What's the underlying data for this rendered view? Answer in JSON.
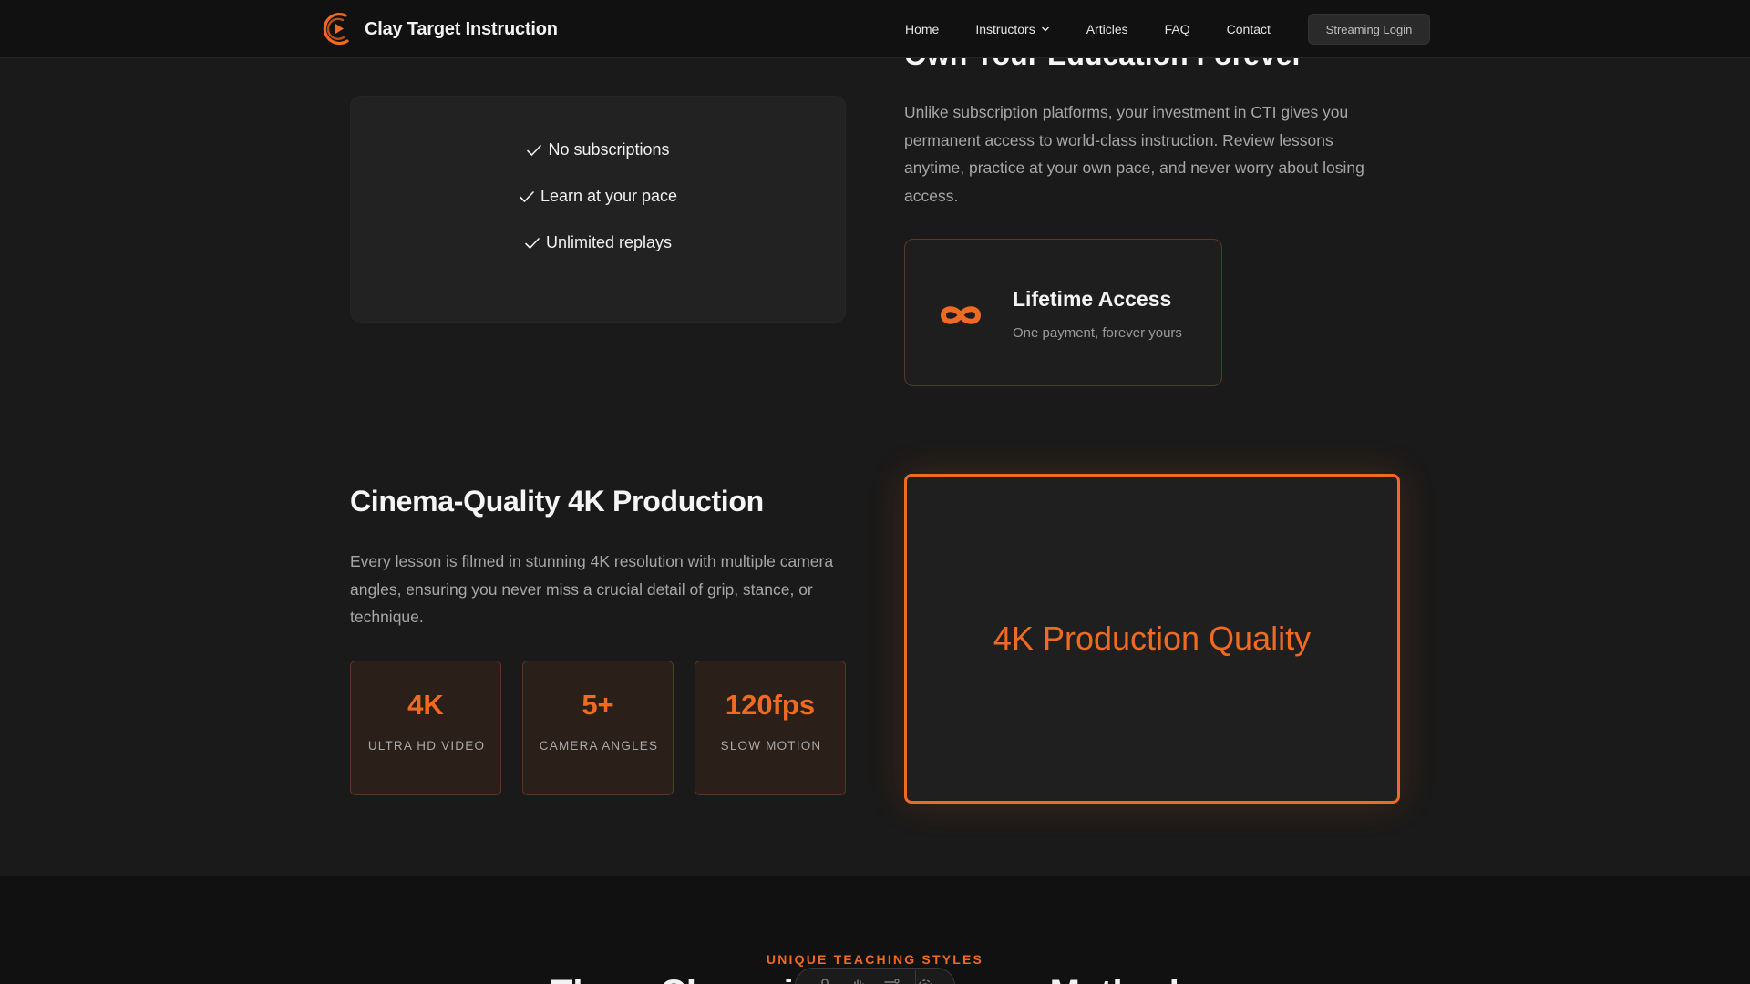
{
  "nav": {
    "brand": "Clay Target Instruction",
    "links": [
      {
        "label": "Home"
      },
      {
        "label": "Instructors"
      },
      {
        "label": "Articles"
      },
      {
        "label": "FAQ"
      },
      {
        "label": "Contact"
      }
    ],
    "login_label": "Streaming Login"
  },
  "ownership": {
    "heading": "Own Your Education Forever",
    "benefits": [
      "No subscriptions",
      "Learn at your pace",
      "Unlimited replays"
    ],
    "paragraph": "Unlike subscription platforms, your investment in CTI gives you permanent access to world-class instruction. Review lessons anytime, practice at your own pace, and never worry about losing access.",
    "card_title": "Lifetime Access",
    "card_subtitle": "One payment, forever yours",
    "card_icon": "infinity-icon"
  },
  "production": {
    "heading": "Cinema-Quality 4K Production",
    "paragraph": "Every lesson is filmed in stunning 4K resolution with multiple camera angles, ensuring you never miss a crucial detail of grip, stance, or technique.",
    "stats": [
      {
        "value": "4K",
        "label": "ULTRA HD VIDEO"
      },
      {
        "value": "5+",
        "label": "CAMERA ANGLES"
      },
      {
        "value": "120fps",
        "label": "SLOW MOTION"
      }
    ],
    "video_label": "4K Production Quality"
  },
  "teaching": {
    "eyebrow": "UNIQUE TEACHING STYLES",
    "heading_left": "Three Champion",
    "heading_right": "Methods"
  },
  "colors": {
    "accent": "#ef6a22",
    "background": "#1a1a1a",
    "navbar": "#111111",
    "card": "#222222",
    "stat_card": "#2b2019"
  }
}
